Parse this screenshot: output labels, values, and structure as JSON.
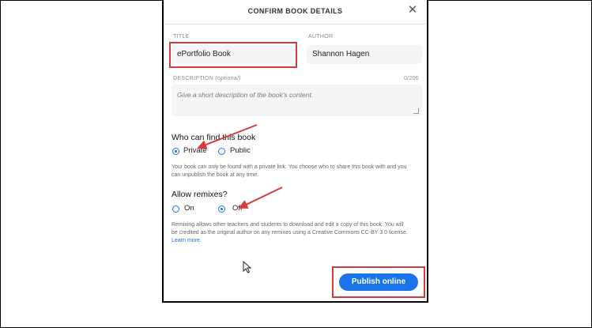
{
  "dialog": {
    "title": "CONFIRM BOOK DETAILS",
    "close_icon": "close-icon"
  },
  "fields": {
    "title_label": "TITLE",
    "title_value": "ePortfolio Book",
    "author_label": "AUTHOR",
    "author_value": "Shannon Hagen",
    "description_label": "DESCRIPTION",
    "description_optional": "(optional)",
    "description_counter": "0/200",
    "description_placeholder": "Give a short description of the book's content."
  },
  "visibility": {
    "heading": "Who can find this book",
    "options": [
      {
        "label": "Private",
        "checked": true
      },
      {
        "label": "Public",
        "checked": false
      }
    ],
    "help": "Your book can only be found with a private link. You choose who to share this book with and you can unpublish the book at any time."
  },
  "remixes": {
    "heading": "Allow remixes?",
    "options": [
      {
        "label": "On",
        "checked": false
      },
      {
        "label": "Off",
        "checked": true
      }
    ],
    "help": "Remixing allows other teachers and students to download and edit a copy of this book. You will be credited as the original author on any remixes using a Creative Commons CC-BY 3.0 license.",
    "learn_more": "Learn more."
  },
  "actions": {
    "publish_label": "Publish online"
  },
  "colors": {
    "accent": "#1a73e8",
    "annotation": "#d63b3b"
  }
}
